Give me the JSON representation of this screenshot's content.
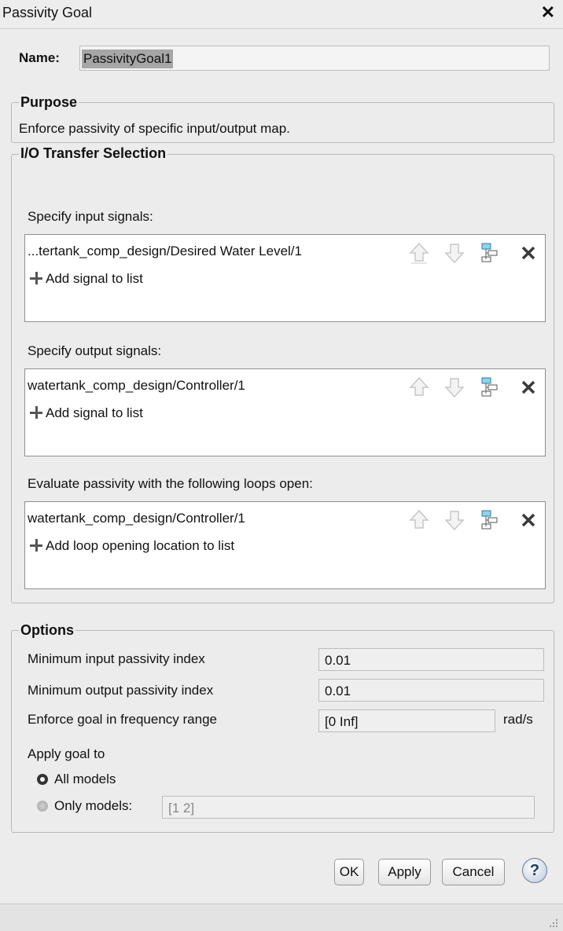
{
  "window": {
    "title": "Passivity Goal"
  },
  "name": {
    "label": "Name:",
    "value": "PassivityGoal1"
  },
  "purpose": {
    "title": "Purpose",
    "text": "Enforce passivity of specific input/output map."
  },
  "io": {
    "title": "I/O Transfer Selection",
    "inputs": {
      "label": "Specify input signals:",
      "signal": "...tertank_comp_design/Desired  Water Level/1",
      "add_label": "Add signal to list"
    },
    "outputs": {
      "label": "Specify output signals:",
      "signal": "watertank_comp_design/Controller/1",
      "add_label": "Add signal to list"
    },
    "loops": {
      "label": "Evaluate passivity with the following loops open:",
      "signal": "watertank_comp_design/Controller/1",
      "add_label": "Add loop opening location to list"
    }
  },
  "options": {
    "title": "Options",
    "min_input": {
      "label": "Minimum input passivity index",
      "value": "0.01"
    },
    "min_output": {
      "label": "Minimum output passivity index",
      "value": "0.01"
    },
    "freq": {
      "label": "Enforce goal in frequency range",
      "value": "[0 Inf]",
      "unit": "rad/s"
    },
    "apply_to": {
      "label": "Apply goal to",
      "all_label": "All models",
      "only_label": "Only models:",
      "only_value": "[1 2]",
      "selected": "all"
    }
  },
  "buttons": {
    "ok": "OK",
    "apply": "Apply",
    "cancel": "Cancel",
    "help": "?"
  },
  "icons": [
    "close-icon",
    "move-up-icon",
    "move-down-icon",
    "select-signal-icon",
    "delete-icon",
    "add-icon",
    "help-icon",
    "resize-grip-icon"
  ]
}
